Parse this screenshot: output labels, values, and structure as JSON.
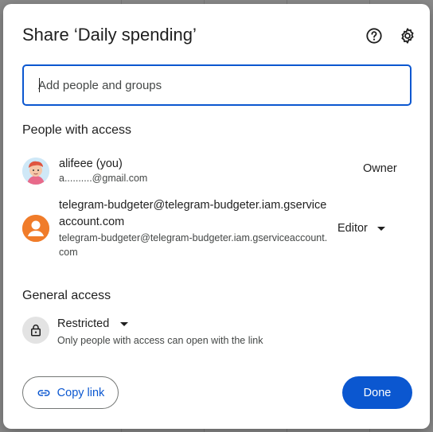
{
  "dialog": {
    "title": "Share ‘Daily spending’",
    "help_icon": "help-circle-icon",
    "settings_icon": "gear-icon"
  },
  "add_people": {
    "placeholder": "Add people and groups",
    "value": ""
  },
  "people_section": {
    "heading": "People with access",
    "people": [
      {
        "name": "alifeee (you)",
        "email": "a..........@gmail.com",
        "role": "Owner",
        "avatar": "illustrated-avatar"
      },
      {
        "name": "telegram-budgeter@telegram-budgeter.iam.gserviceaccount.com",
        "email": "telegram-budgeter@telegram-budgeter.iam.gserviceaccount.com",
        "role": "Editor",
        "avatar": "person-icon"
      }
    ]
  },
  "general_access": {
    "heading": "General access",
    "level": "Restricted",
    "description": "Only people with access can open with the link",
    "icon": "lock-icon"
  },
  "footer": {
    "copy_link_label": "Copy link",
    "done_label": "Done"
  },
  "colors": {
    "primary": "#0b57d0",
    "avatar_orange": "#f07c2a",
    "text": "#1f1f1f",
    "secondary_text": "#444746"
  }
}
